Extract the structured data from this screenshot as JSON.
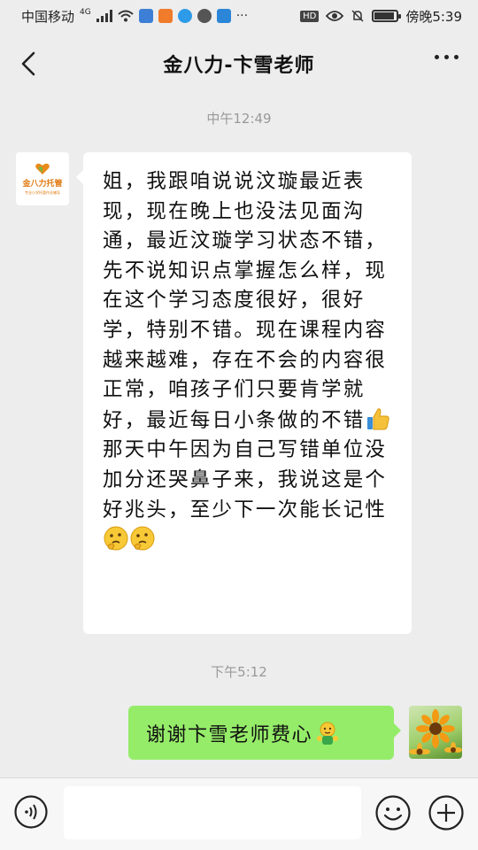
{
  "status_bar": {
    "carrier": "中国移动",
    "network": "4G",
    "time": "傍晚5:39",
    "hd_label": "HD"
  },
  "header": {
    "title": "金八力-卞雪老师"
  },
  "messages": {
    "time_1": "中午12:49",
    "incoming_text": "姐，我跟咱说说汶璇最近表现，现在晚上也没法见面沟通，最近汶璇学习状态不错，先不说知识点掌握怎么样，现在这个学习态度很好，很好学，特别不错。现在课程内容越来越难，存在不会的内容很正常，咱孩子们只要肯学就好，最近每日小条做的不错",
    "incoming_text_2": "那天中午因为自己写错单位没加分还哭鼻子来，我说这是个好兆头，至少下一次能长记性",
    "time_2": "下午5:12",
    "outgoing_text": "谢谢卞雪老师费心"
  },
  "avatar_left": {
    "logo_text": "金八力托管",
    "logo_sub": "专业小学托管作业辅导"
  },
  "icons": {
    "back": "chevron-left-icon",
    "more": "more-dots-icon",
    "voice": "voice-icon",
    "emoji": "smiley-icon",
    "plus": "plus-circle-icon",
    "thumbs_up": "thumbs-up-emoji",
    "thinking": "thinking-face-emoji",
    "hug": "hugging-emoji"
  },
  "colors": {
    "outgoing_bubble": "#95ec69",
    "incoming_bubble": "#ffffff",
    "background": "#ededed"
  }
}
